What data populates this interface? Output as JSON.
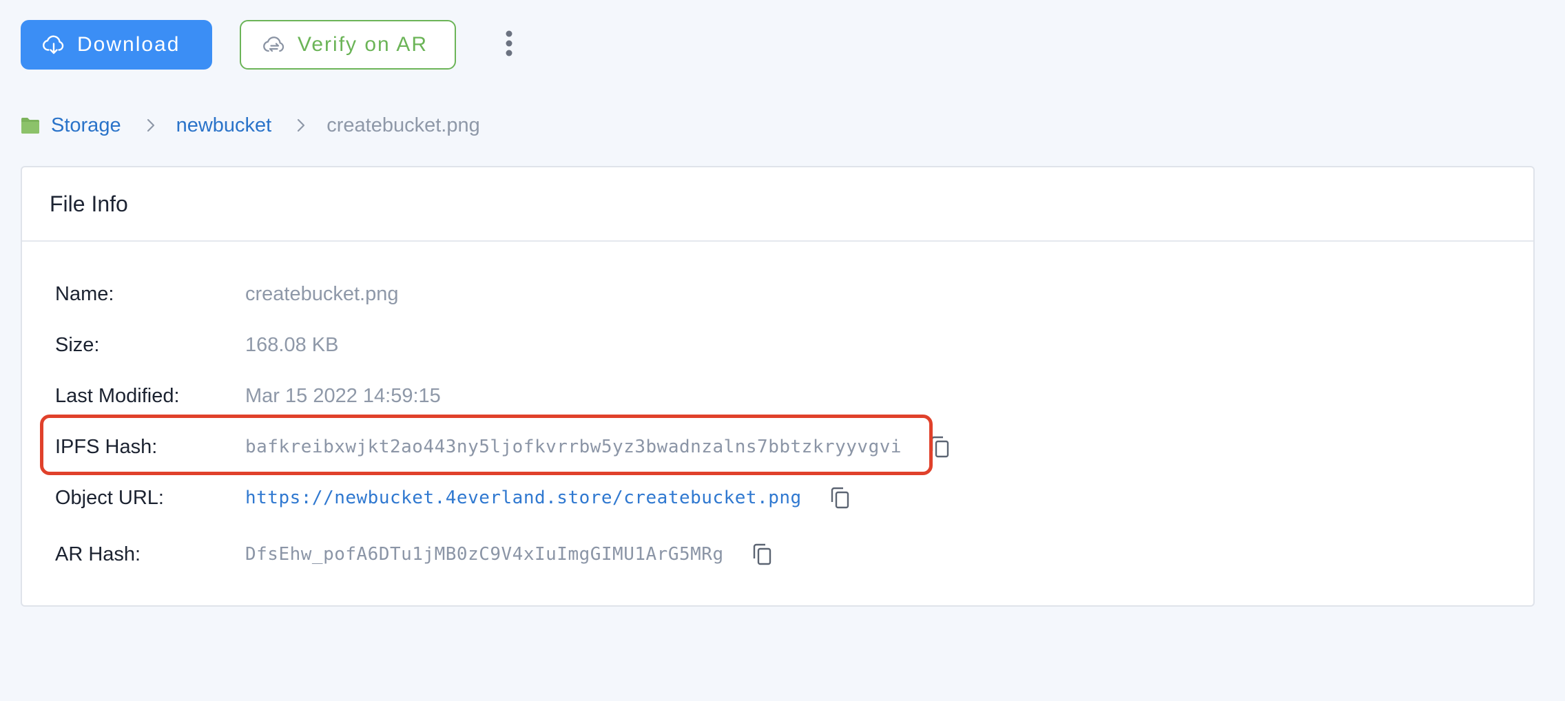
{
  "toolbar": {
    "download_label": "Download",
    "verify_label": "Verify on AR",
    "download_icon": "cloud-download-icon",
    "verify_icon": "cloud-sync-icon",
    "more_icon": "more-vertical-icon"
  },
  "breadcrumb": {
    "items": [
      "Storage",
      "newbucket",
      "createbucket.png"
    ]
  },
  "file_info": {
    "title": "File Info",
    "name_label": "Name:",
    "name_value": "createbucket.png",
    "size_label": "Size:",
    "size_value": "168.08 KB",
    "modified_label": "Last Modified:",
    "modified_value": "Mar 15 2022 14:59:15",
    "ipfs_label": "IPFS Hash:",
    "ipfs_value": "bafkreibxwjkt2ao443ny5ljofkvrrbw5yz3bwadnzalns7bbtzkryyvgvi",
    "url_label": "Object URL:",
    "url_value": "https://newbucket.4everland.store/createbucket.png",
    "ar_label": "AR Hash:",
    "ar_value": "DfsEhw_pofA6DTu1jMB0zC9V4xIuImgGIMU1ArG5MRg"
  },
  "colors": {
    "primary": "#3b8ef5",
    "success": "#6bb457",
    "link": "#2a73c9",
    "highlight": "#e0412b",
    "background": "#f4f7fc"
  }
}
